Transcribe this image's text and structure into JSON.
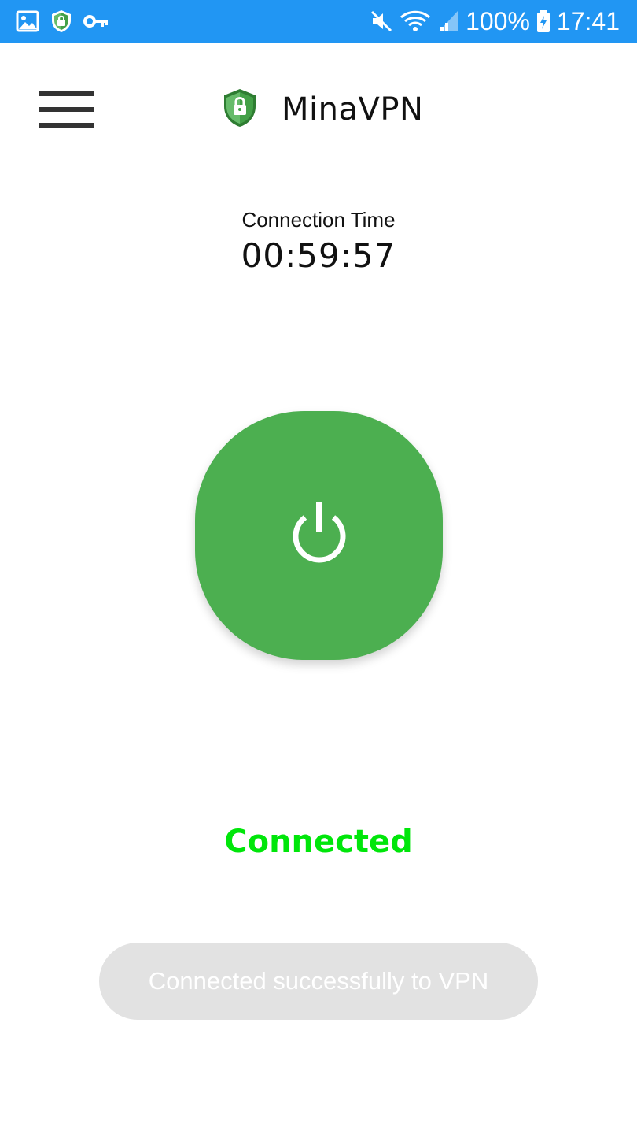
{
  "status_bar": {
    "left_icons": [
      "gallery-icon",
      "vpn-shield-icon",
      "vpn-key-icon"
    ],
    "right_icons": [
      "mute-icon",
      "wifi-icon",
      "signal-icon",
      "battery-charging-icon"
    ],
    "battery": "100%",
    "time": "17:41",
    "color": "#2196f3"
  },
  "header": {
    "menu_icon": "hamburger-menu-icon",
    "logo_icon": "shield-lock-icon",
    "app_name": "MinaVPN"
  },
  "connection": {
    "label": "Connection Time",
    "timer": "00:59:57"
  },
  "power_button": {
    "icon": "power-icon",
    "color": "#4caf50"
  },
  "status": {
    "text": "Connected",
    "color": "#00e60a"
  },
  "toast": {
    "text": "Connected successfully to VPN"
  }
}
